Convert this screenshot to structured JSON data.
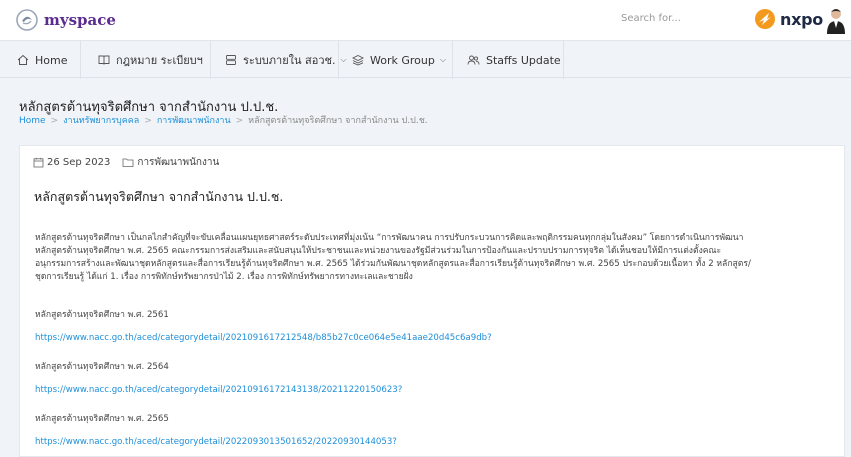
{
  "header": {
    "logo_text": "myspace",
    "search_placeholder": "Search for...",
    "brand_text": "nxpo"
  },
  "nav": {
    "items": [
      {
        "label": "Home",
        "icon": "home-icon"
      },
      {
        "label": "กฎหมาย ระเบียบฯ",
        "icon": "book-icon"
      },
      {
        "label": "ระบบภายใน สอวช.",
        "icon": "server-icon",
        "dropdown": true
      },
      {
        "label": "Work Group",
        "icon": "layers-icon",
        "dropdown": true
      },
      {
        "label": "Staffs Update",
        "icon": "users-icon"
      }
    ]
  },
  "page": {
    "title": "หลักสูตรต้านทุจริตศึกษา จากสำนักงาน ป.ป.ช.",
    "breadcrumb": [
      {
        "label": "Home",
        "link": true
      },
      {
        "label": "งานทรัพยากรบุคคล",
        "link": true
      },
      {
        "label": "การพัฒนาพนักงาน",
        "link": true
      },
      {
        "label": "หลักสูตรต้านทุจริตศึกษา จากสำนักงาน ป.ป.ช.",
        "link": false
      }
    ]
  },
  "article": {
    "date": "26 Sep 2023",
    "category": "การพัฒนาพนักงาน",
    "title": "หลักสูตรต้านทุจริตศึกษา จากสำนักงาน ป.ป.ช.",
    "paragraph_lines": [
      "หลักสูตรต้านทุจริตศึกษา เป็นกลไกสำคัญที่จะขับเคลื่อนแผนยุทธศาสตร์ระดับประเทศที่มุ่งเน้น “การพัฒนาคน การปรับกระบวนการคิดและพฤติกรรมคนทุกกลุ่มในสังคม” โดยการดำเนินการพัฒนา",
      "หลักสูตรต้านทุจริตศึกษา พ.ศ. 2565 คณะกรรมการส่งเสริมและสนับสนุนให้ประชาชนและหน่วยงานของรัฐมีส่วนร่วมในการป้องกันและปราบปรามการทุจริต ได้เห็นชอบให้มีการแต่งตั้งคณะ",
      "อนุกรรมการสร้างและพัฒนาชุดหลักสูตรและสื่อการเรียนรู้ต้านทุจริตศึกษา พ.ศ. 2565 ได้ร่วมกันพัฒนาชุดหลักสูตรและสื่อการเรียนรู้ต้านทุจริตศึกษา พ.ศ. 2565 ประกอบด้วยเนื้อหา ทั้ง 2 หลักสูตร/",
      "ชุดการเรียนรู้ ได้แก่ 1. เรื่อง การพิทักษ์ทรัพยากรป่าไม้ 2. เรื่อง การพิทักษ์ทรัพยากรทางทะเลและชายฝั่ง"
    ],
    "courses": [
      {
        "label": "หลักสูตรต้านทุจริตศึกษา พ.ศ. 2561",
        "url": "https://www.nacc.go.th/aced/categorydetail/2021091617212548/b85b27c0ce064e5e41aae20d45c6a9db?"
      },
      {
        "label": "หลักสูตรต้านทุจริตศึกษา พ.ศ. 2564",
        "url": "https://www.nacc.go.th/aced/categorydetail/20210916172143138/20211220150623?"
      },
      {
        "label": "หลักสูตรต้านทุจริตศึกษา พ.ศ. 2565",
        "url": "https://www.nacc.go.th/aced/categorydetail/20220930135016​52/20220930144053?"
      }
    ]
  },
  "colors": {
    "logo": "#5b2c8e",
    "link": "#1e8fd8",
    "nxpo_orange": "#f39a1e",
    "background": "#f0f4f8"
  }
}
